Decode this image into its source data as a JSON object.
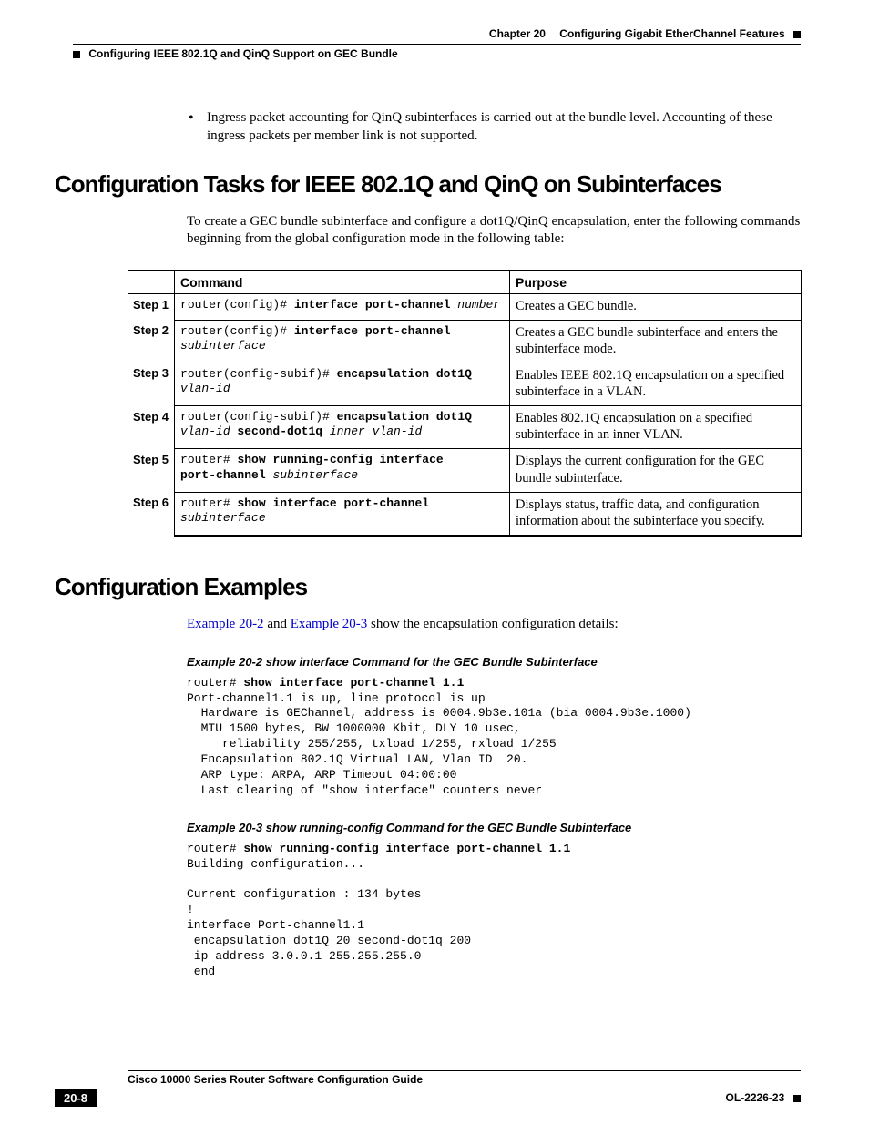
{
  "header": {
    "chapter_label": "Chapter 20",
    "chapter_title": "Configuring Gigabit EtherChannel Features",
    "section_title": "Configuring IEEE 802.1Q and QinQ Support on GEC Bundle"
  },
  "bullets": {
    "b1": "Ingress packet accounting for QinQ subinterfaces is carried out at the bundle level. Accounting of these ingress packets per member link is not supported."
  },
  "h1": "Configuration Tasks for IEEE 802.1Q and QinQ on Subinterfaces",
  "intro": "To create a GEC bundle subinterface and configure a dot1Q/QinQ encapsulation, enter the following commands beginning from the global configuration mode in the following table:",
  "table": {
    "head_cmd": "Command",
    "head_purpose": "Purpose",
    "rows": [
      {
        "step": "Step 1",
        "cmd_prefix": "router(config)# ",
        "cmd_bold": "interface port-channel",
        "cmd_arg": " number",
        "purpose": "Creates a GEC bundle."
      },
      {
        "step": "Step 2",
        "cmd_prefix": "router(config)# ",
        "cmd_bold": "interface port-channel",
        "cmd_arg": " subinterface",
        "purpose": "Creates a GEC bundle subinterface and enters the subinterface mode."
      },
      {
        "step": "Step 3",
        "cmd_prefix": "router(config-subif)# ",
        "cmd_bold": "encapsulation dot1Q",
        "cmd_arg": " vlan-id",
        "purpose": "Enables IEEE 802.1Q encapsulation on a specified subinterface in a VLAN."
      },
      {
        "step": "Step 4",
        "cmd_prefix": "router(config-subif)# ",
        "cmd_bold": "encapsulation dot1Q",
        "cmd_arg": " vlan-id",
        "cmd_bold2": " second-dot1q",
        "cmd_arg2": " inner vlan-id",
        "purpose": "Enables 802.1Q encapsulation on a specified subinterface in an inner VLAN."
      },
      {
        "step": "Step 5",
        "cmd_prefix": "router# ",
        "cmd_bold": "show running-config interface port-channel",
        "cmd_arg": " subinterface",
        "purpose": "Displays the current configuration for the GEC bundle subinterface."
      },
      {
        "step": "Step 6",
        "cmd_prefix": "router# ",
        "cmd_bold": "show interface port-channel",
        "cmd_arg": " subinterface",
        "purpose": "Displays status, traffic data, and configuration information about the subinterface you specify."
      }
    ]
  },
  "h2": "Configuration Examples",
  "examples_intro": {
    "link1": "Example 20-2",
    "mid": " and ",
    "link2": "Example 20-3",
    "tail": " show the encapsulation configuration details:"
  },
  "ex1": {
    "label": "Example 20-2   show interface Command for the GEC Bundle Subinterface",
    "prompt": "router# ",
    "cmd": "show interface port-channel 1.1",
    "body": "Port-channel1.1 is up, line protocol is up\n  Hardware is GEChannel, address is 0004.9b3e.101a (bia 0004.9b3e.1000)\n  MTU 1500 bytes, BW 1000000 Kbit, DLY 10 usec,\n     reliability 255/255, txload 1/255, rxload 1/255\n  Encapsulation 802.1Q Virtual LAN, Vlan ID  20.\n  ARP type: ARPA, ARP Timeout 04:00:00\n  Last clearing of \"show interface\" counters never"
  },
  "ex2": {
    "label": "Example 20-3   show running-config Command for the GEC Bundle Subinterface",
    "prompt": "router# ",
    "cmd": "show running-config interface port-channel 1.1",
    "body": "Building configuration...\n\nCurrent configuration : 134 bytes\n!\ninterface Port-channel1.1\n encapsulation dot1Q 20 second-dot1q 200\n ip address 3.0.0.1 255.255.255.0\n end"
  },
  "footer": {
    "guide": "Cisco 10000 Series Router Software Configuration Guide",
    "pagenum": "20-8",
    "docid": "OL-2226-23"
  }
}
